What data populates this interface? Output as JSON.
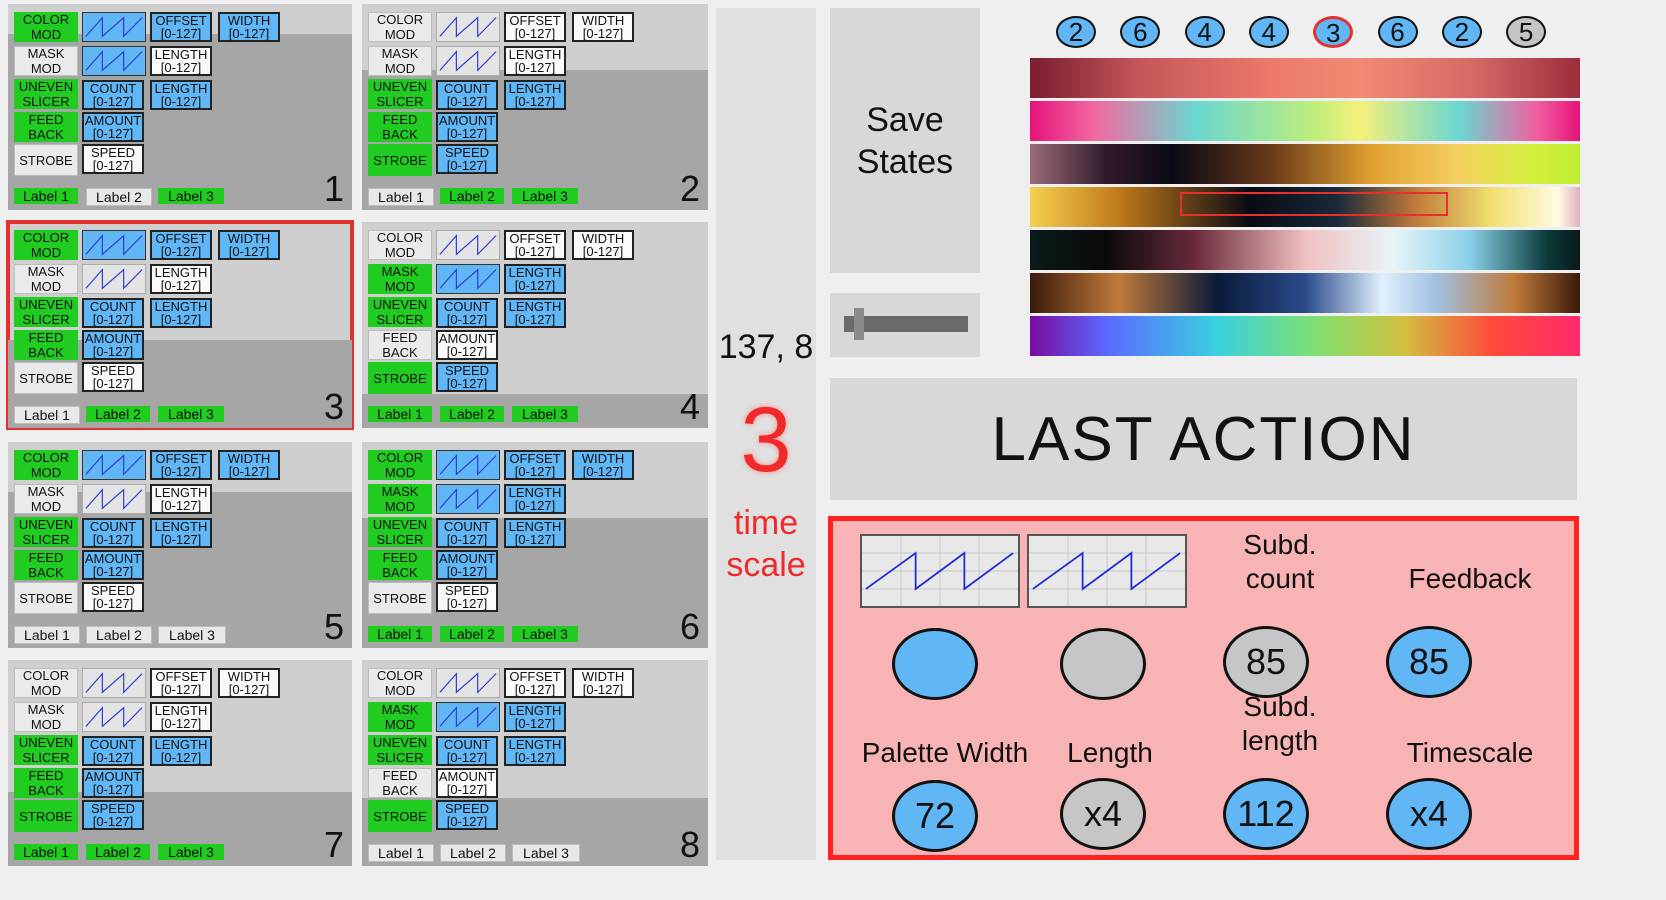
{
  "panels": [
    {
      "num": "1",
      "selected": false,
      "color_mod": true,
      "mask_mod": false,
      "uneven": true,
      "feed": true,
      "strobe": false,
      "wave1": "blue",
      "wave2": "blue",
      "offset": "blue",
      "width": "blue",
      "length1": "white",
      "count": "blue",
      "length2": "blue",
      "amount": "blue",
      "speed": "white",
      "labels": [
        true,
        false,
        true
      ]
    },
    {
      "num": "2",
      "selected": false,
      "color_mod": false,
      "mask_mod": false,
      "uneven": true,
      "feed": true,
      "strobe": true,
      "wave1": "grey",
      "wave2": "grey",
      "offset": "white",
      "width": "white",
      "length1": "white",
      "count": "blue",
      "length2": "blue",
      "amount": "blue",
      "speed": "blue",
      "labels": [
        false,
        true,
        true
      ]
    },
    {
      "num": "3",
      "selected": true,
      "color_mod": true,
      "mask_mod": false,
      "uneven": true,
      "feed": true,
      "strobe": false,
      "wave1": "blue",
      "wave2": "grey",
      "offset": "blue",
      "width": "blue",
      "length1": "white",
      "count": "blue",
      "length2": "blue",
      "amount": "blue",
      "speed": "white",
      "labels": [
        false,
        true,
        true
      ]
    },
    {
      "num": "4",
      "selected": false,
      "color_mod": false,
      "mask_mod": true,
      "uneven": true,
      "feed": false,
      "strobe": true,
      "wave1": "grey",
      "wave2": "blue",
      "offset": "white",
      "width": "white",
      "length1": "blue",
      "count": "blue",
      "length2": "blue",
      "amount": "white",
      "speed": "blue",
      "labels": [
        true,
        true,
        true
      ]
    },
    {
      "num": "5",
      "selected": false,
      "color_mod": true,
      "mask_mod": false,
      "uneven": true,
      "feed": true,
      "strobe": false,
      "wave1": "blue",
      "wave2": "grey",
      "offset": "blue",
      "width": "blue",
      "length1": "white",
      "count": "blue",
      "length2": "blue",
      "amount": "blue",
      "speed": "white",
      "labels": [
        false,
        false,
        false
      ]
    },
    {
      "num": "6",
      "selected": false,
      "color_mod": true,
      "mask_mod": true,
      "uneven": true,
      "feed": true,
      "strobe": false,
      "wave1": "blue",
      "wave2": "blue",
      "offset": "blue",
      "width": "blue",
      "length1": "blue",
      "count": "blue",
      "length2": "blue",
      "amount": "blue",
      "speed": "white",
      "labels": [
        true,
        true,
        true
      ]
    },
    {
      "num": "7",
      "selected": false,
      "color_mod": false,
      "mask_mod": false,
      "uneven": true,
      "feed": true,
      "strobe": true,
      "wave1": "grey",
      "wave2": "grey",
      "offset": "white",
      "width": "white",
      "length1": "white",
      "count": "blue",
      "length2": "blue",
      "amount": "blue",
      "speed": "blue",
      "labels": [
        true,
        true,
        true
      ]
    },
    {
      "num": "8",
      "selected": false,
      "color_mod": false,
      "mask_mod": true,
      "uneven": true,
      "feed": false,
      "strobe": true,
      "wave1": "grey",
      "wave2": "blue",
      "offset": "white",
      "width": "white",
      "length1": "blue",
      "count": "blue",
      "length2": "blue",
      "amount": "white",
      "speed": "blue",
      "labels": [
        false,
        false,
        false
      ]
    }
  ],
  "panel_text": {
    "color_mod": [
      "COLOR",
      "MOD"
    ],
    "mask_mod": [
      "MASK",
      "MOD"
    ],
    "uneven": [
      "UNEVEN",
      "SLICER"
    ],
    "feed": [
      "FEED",
      "BACK"
    ],
    "strobe": "STROBE",
    "offset": [
      "OFFSET",
      "[0-127]"
    ],
    "width": [
      "WIDTH",
      "[0-127]"
    ],
    "length": [
      "LENGTH",
      "[0-127]"
    ],
    "count": [
      "COUNT",
      "[0-127]"
    ],
    "amount": [
      "AMOUNT",
      "[0-127]"
    ],
    "speed": [
      "SPEED",
      "[0-127]"
    ],
    "labels": [
      "Label 1",
      "Label 2",
      "Label 3"
    ]
  },
  "center": {
    "coords": "137, 8",
    "big_number": "3",
    "time_scale_line1": "time",
    "time_scale_line2": "scale"
  },
  "save_states": {
    "line1": "Save",
    "line2": "States"
  },
  "slider": {
    "value": 0.12
  },
  "palette_circles": [
    {
      "value": "2",
      "style": "blue"
    },
    {
      "value": "6",
      "style": "blue"
    },
    {
      "value": "4",
      "style": "blue"
    },
    {
      "value": "4",
      "style": "blue"
    },
    {
      "value": "3",
      "style": "red"
    },
    {
      "value": "6",
      "style": "blue"
    },
    {
      "value": "2",
      "style": "blue"
    },
    {
      "value": "5",
      "style": "grey"
    }
  ],
  "palettes_selected_index": 3,
  "last_action": "LAST ACTION",
  "controls": {
    "subd_count_label": [
      "Subd.",
      "count"
    ],
    "feedback_label": "Feedback",
    "palette_width_label": "Palette Width",
    "length_label": "Length",
    "subd_length_label": [
      "Subd.",
      "length"
    ],
    "timescale_label": "Timescale",
    "subd_count": "85",
    "feedback": "85",
    "palette_width": "72",
    "length": "x4",
    "subd_length": "112",
    "timescale": "x4"
  },
  "colors": {
    "accent_red": "#e53030",
    "blue": "#61b6f5",
    "green": "#1fcc1f",
    "grey": "#c4c4c4"
  }
}
